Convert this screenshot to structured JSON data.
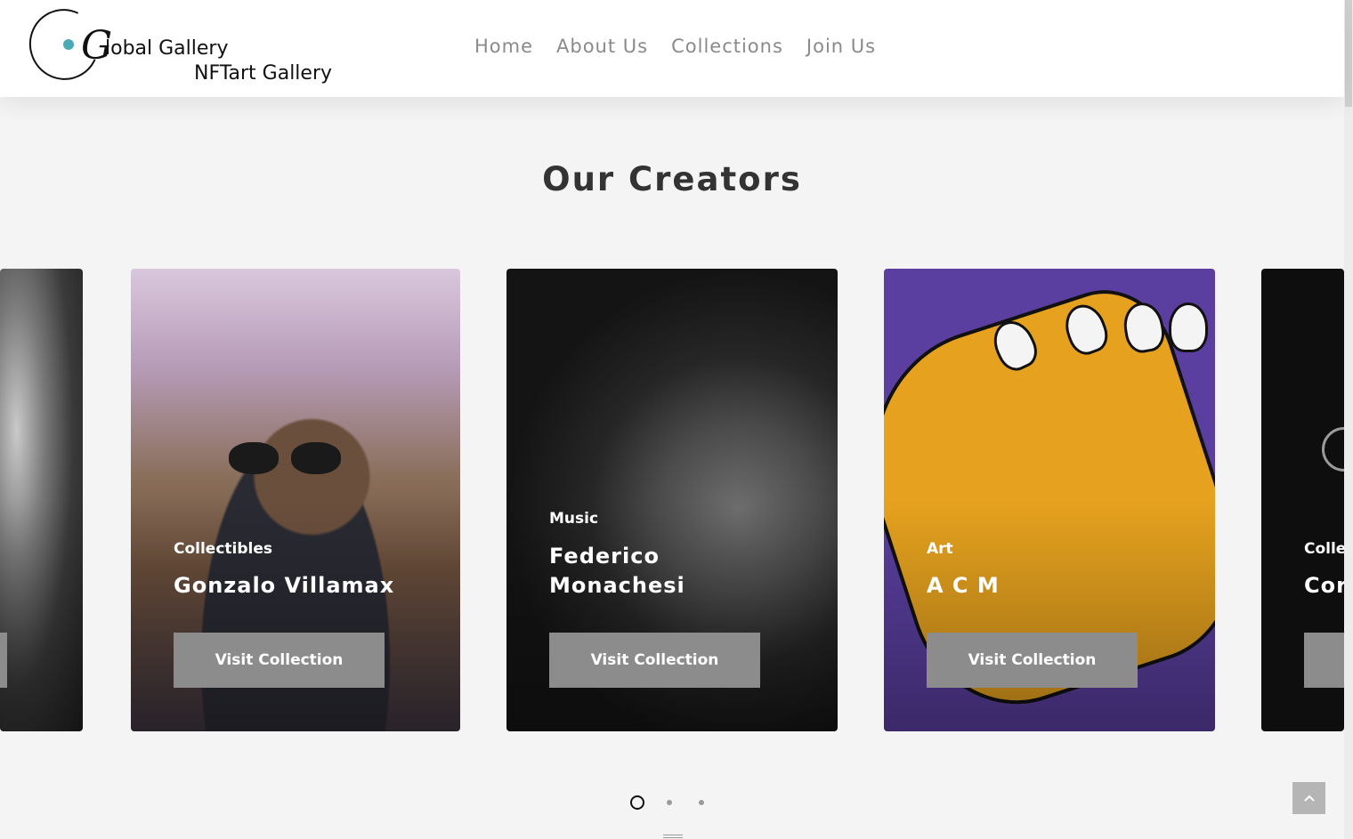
{
  "logo": {
    "g_letter": "G",
    "line1": "lobal Gallery",
    "line2": "NFTart Gallery",
    "accent_color": "#4aa9b6"
  },
  "nav": {
    "items": [
      {
        "label": "Home"
      },
      {
        "label": "About Us"
      },
      {
        "label": "Collections"
      },
      {
        "label": "Join Us"
      }
    ]
  },
  "section": {
    "title": "Our Creators"
  },
  "cards": [
    {
      "category": "",
      "name": "",
      "button": ""
    },
    {
      "category": "Collectibles",
      "name": "Gonzalo Villamax",
      "button": "Visit Collection"
    },
    {
      "category": "Music",
      "name": "Federico Monachesi",
      "button": "Visit Collection"
    },
    {
      "category": "Art",
      "name": "A C M",
      "button": "Visit Collection"
    },
    {
      "category": "Colle",
      "name": "Cor",
      "button": ""
    }
  ],
  "pagination": {
    "pages": 3,
    "active_index": 0
  },
  "icons": {
    "back_to_top": "chevron-up-icon"
  }
}
